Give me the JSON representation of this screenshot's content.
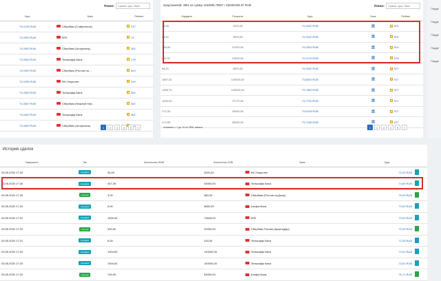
{
  "left": {
    "search_label": "Поиск:",
    "search_placeholder": "Сумма, курс, банк",
    "headers": [
      "Курс",
      "Банк",
      "Рейтинг"
    ],
    "rows": [
      {
        "rate": "74,0145 RUB",
        "bank": "Сбербанк (Ставрополь)",
        "rating": "237"
      },
      {
        "rate": "74,0000 RUB",
        "bank": "ВТБ",
        "rating": "76"
      },
      {
        "rate": "74,0000 RUB",
        "bank": "Сбербанк (Астрахань)",
        "rating": "362"
      },
      {
        "rate": "74,0000 RUB",
        "bank": "Тинькофф Банк",
        "rating": "178"
      },
      {
        "rate": "74,0000 RUB",
        "bank": "Сбербанк (Ростов на ...",
        "rating": "543"
      },
      {
        "rate": "74,2295 RUB",
        "bank": "ФК Открытие",
        "rating": "149"
      },
      {
        "rate": "74,2600 RUB",
        "bank": "Тинькофф Банк",
        "rating": "362"
      },
      {
        "rate": "74,3067 RUB",
        "bank": "Сбербанк (Нижний Нов...",
        "rating": "362"
      },
      {
        "rate": "74,4000 RUB",
        "bank": "Тинькофф Банк",
        "rating": "362"
      },
      {
        "rate": "74,4500 RUB",
        "bank": "Сбербанк (Астрахань)",
        "rating": "632"
      }
    ],
    "pages": [
      "1",
      "2",
      "3",
      "4",
      "5",
      "»"
    ]
  },
  "middle": {
    "subtitle": "предложений: 3951 на сумму 1462696,79067 / 108453335.57 RUB",
    "search_label": "Поиск:",
    "search_placeholder": "Сумма, курс, банк",
    "headers": [
      "Отдадите",
      "Получите",
      "Курс",
      "Банк",
      "Рейтинг"
    ],
    "rows": [
      {
        "give": "13,46",
        "get": "1000,00",
        "rate": "74,2942 RUB",
        "rating": "601"
      },
      {
        "give": "26,92",
        "get": "2000,00",
        "rate": "74,2942 RUB",
        "rating": "601"
      },
      {
        "give": "498,65",
        "get": "37000,00",
        "rate": "74,2003 RUB",
        "rating": "504"
      },
      {
        "give": "202,37",
        "get": "15000,00",
        "rate": "74,1213 RUB",
        "rating": "578"
      },
      {
        "give": "68,21",
        "get": "5000,00",
        "rate": "74,0000 RUB",
        "rating": "527"
      },
      {
        "give": "1897,02",
        "get": "140000,00",
        "rate": "73,8000 RUB",
        "rating": "927"
      },
      {
        "give": "1355,75",
        "get": "100000,00",
        "rate": "73,7589 RUB",
        "rating": "927"
      },
      {
        "give": "1000,00",
        "get": "73770,00",
        "rate": "73,7700 RUB",
        "rating": "927"
      },
      {
        "give": "272,33",
        "get": "20000,00",
        "rate": "73,5318 RUB",
        "rating": "927"
      },
      {
        "give": "474,83",
        "get": "35000,00",
        "rate": "73,7186 RUB",
        "rating": "927"
      }
    ],
    "showing": "показано с 1 до 10 из 3951 записи",
    "pages": [
      "1",
      "2",
      "3",
      "4",
      "5",
      "»"
    ]
  },
  "history": {
    "title": "История сделок",
    "headers": [
      "Завершено",
      "Тип",
      "Количество ФИАТ",
      "Количество RUB",
      "Банк",
      "Курс"
    ],
    "rows": [
      {
        "date": "03.05.2020 17:33",
        "type": "продажа",
        "ok": false,
        "fiat": "35,00",
        "rub": "2520,00",
        "bank": "ФК Открытие",
        "rate": "72,00 RUB"
      },
      {
        "date": "03.05.2020 17:26",
        "type": "продажа",
        "ok": false,
        "fiat": "457,35",
        "rub": "33900,00",
        "bank": "Тинькофф Банк",
        "rate": "74,80 RUB"
      },
      {
        "date": "03.05.2020 17:25",
        "type": "покупка",
        "ok": true,
        "fiat": "3,00",
        "rub": "380,00",
        "bank": "Сбербанк (Ростов на Дону)",
        "rate": "75,00 RUB"
      },
      {
        "date": "03.05.2020 17:24",
        "type": "продажа",
        "ok": false,
        "fiat": "5,00",
        "rub": "3650,00",
        "bank": "Альфа Банк",
        "rate": "73,00 RUB"
      },
      {
        "date": "03.05.2020 17:22",
        "type": "продажа",
        "ok": false,
        "fiat": "1000,00",
        "rub": "73525,00",
        "bank": "ВТБ",
        "rate": "73,52 RUB"
      },
      {
        "date": "03.05.2020 17:22",
        "type": "покупка",
        "ok": true,
        "fiat": "300,00",
        "rub": "22000,00",
        "bank": "Сбербанк Россия (Краснодар)",
        "rate": "73,33 RUB"
      },
      {
        "date": "03.05.2020 17:21",
        "type": "продажа",
        "ok": false,
        "fiat": "6,00",
        "rub": "434,00",
        "bank": "Тинькофф Банк",
        "rate": "72,33 RUB"
      },
      {
        "date": "03.05.2020 17:20",
        "type": "продажа",
        "ok": false,
        "fiat": "1904,50",
        "rub": "140000,00",
        "bank": "Тинькофф Банк",
        "rate": "73,51 RUB"
      },
      {
        "date": "03.05.2020 17:20",
        "type": "продажа",
        "ok": false,
        "fiat": "1904,50",
        "rub": "140000,00",
        "bank": "Тинькофф Банк",
        "rate": "73,51 RUB"
      },
      {
        "date": "03.05.2020 17:20",
        "type": "покупка",
        "ok": true,
        "fiat": "700,00",
        "rub": "53000,00",
        "bank": "Альфа Банк",
        "rate": "75,71 RUB"
      }
    ]
  },
  "side": {
    "labels": [
      "Подде",
      "Подде",
      "Подде",
      "Подде",
      "Подде"
    ]
  },
  "colors": {
    "accent": "#2a6bb5",
    "highlight": "#d62b2b",
    "buy": "#28a745",
    "sell": "#17a2b8"
  }
}
